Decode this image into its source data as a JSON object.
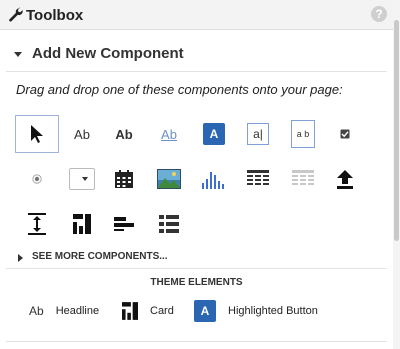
{
  "toolbox": {
    "title": "Toolbox",
    "help_glyph": "?"
  },
  "section": {
    "title": "Add New Component",
    "instructions": "Drag and drop one of these components onto your page:"
  },
  "components": [
    {
      "icon": "pointer-icon",
      "label": ""
    },
    {
      "icon": "text-icon",
      "label": "Ab"
    },
    {
      "icon": "bold-text-icon",
      "label": "Ab"
    },
    {
      "icon": "link-text-icon",
      "label": "Ab"
    },
    {
      "icon": "button-icon",
      "label": "A"
    },
    {
      "icon": "text-input-icon",
      "label": "a"
    },
    {
      "icon": "textarea-icon",
      "label": "a b"
    },
    {
      "icon": "checkbox-icon",
      "label": ""
    },
    {
      "icon": "radio-icon",
      "label": ""
    },
    {
      "icon": "dropdown-icon",
      "label": ""
    },
    {
      "icon": "calendar-icon",
      "label": ""
    },
    {
      "icon": "image-icon",
      "label": ""
    },
    {
      "icon": "chart-icon",
      "label": ""
    },
    {
      "icon": "table-icon",
      "label": ""
    },
    {
      "icon": "grid-icon",
      "label": ""
    },
    {
      "icon": "upload-icon",
      "label": ""
    },
    {
      "icon": "spacer-icon",
      "label": ""
    },
    {
      "icon": "card-icon",
      "label": ""
    },
    {
      "icon": "layout-icon",
      "label": ""
    },
    {
      "icon": "list-icon",
      "label": ""
    }
  ],
  "see_more": {
    "label": "SEE MORE COMPONENTS..."
  },
  "theme_elements": {
    "title": "THEME ELEMENTS",
    "items": [
      {
        "icon": "text-icon",
        "glyph": "Ab",
        "label": "Headline"
      },
      {
        "icon": "card-icon",
        "glyph": "",
        "label": "Card"
      },
      {
        "icon": "button-icon",
        "glyph": "A",
        "label": "Highlighted Button"
      }
    ]
  },
  "colors": {
    "accent": "#2a66b1",
    "link": "#6e8fc8",
    "selection": "#9fb4dd"
  }
}
